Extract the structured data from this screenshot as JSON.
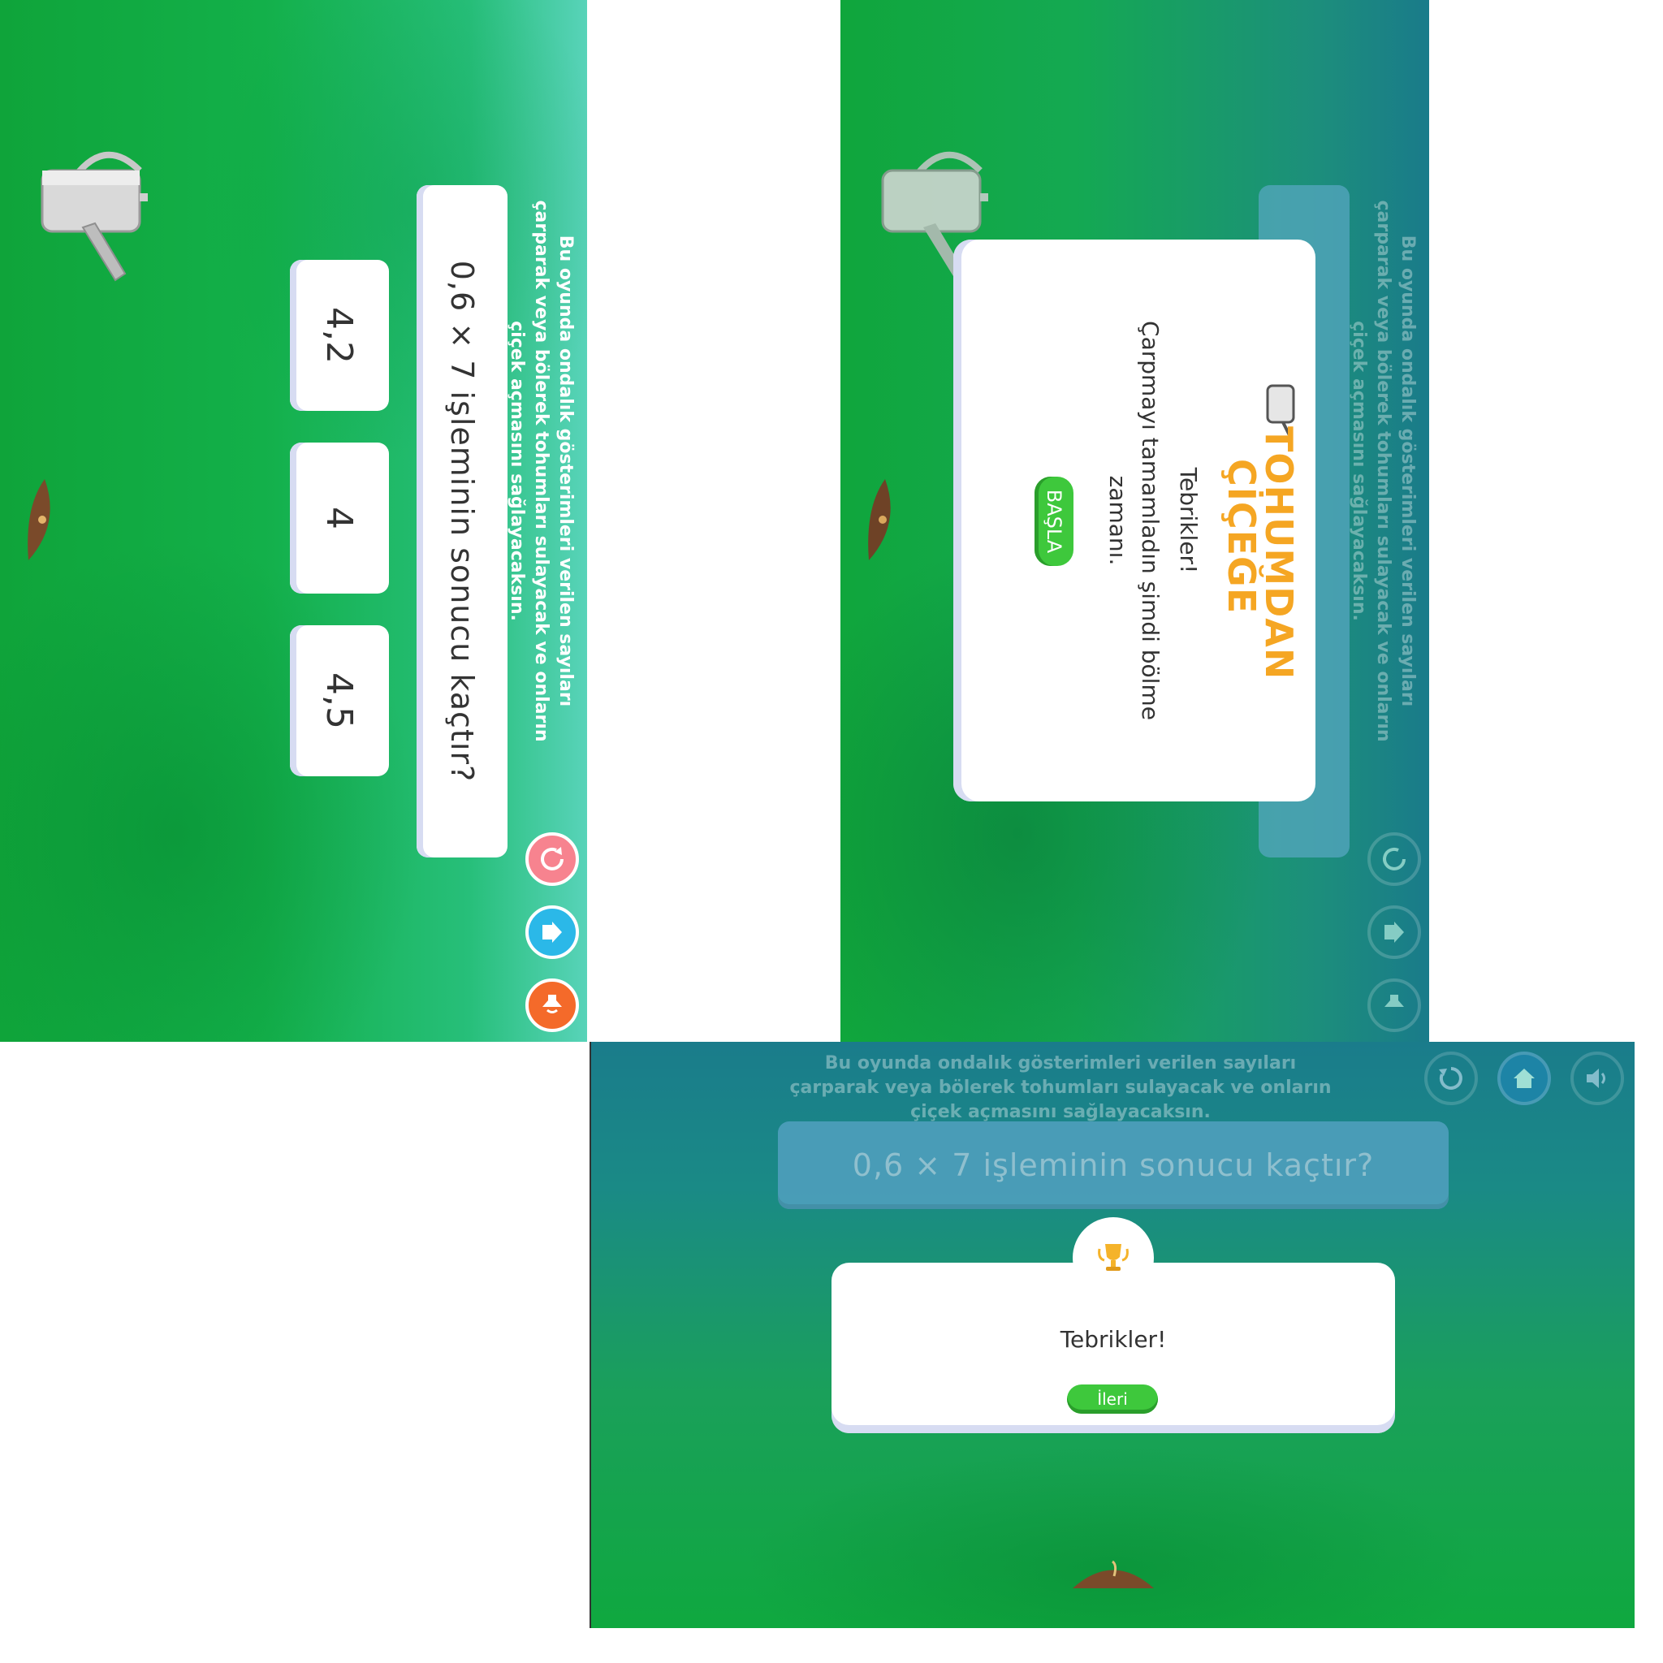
{
  "instructions": "Bu oyunda ondalık gösterimleri verilen sayıları çarparak veya bölerek tohumları sulayacak ve onların çiçek açmasını sağlayacaksın.",
  "question": "0,6 × 7 işleminin sonucu kaçtır?",
  "answers": [
    "4,2",
    "4",
    "4,5"
  ],
  "controls": {
    "restart_icon": "restart-icon",
    "home_icon": "home-icon",
    "sound_icon": "sound-icon"
  },
  "intro_modal": {
    "logo_line1": "TOHUMDAN",
    "logo_line2": "ÇİÇEĞE",
    "title": "Tebrikler!",
    "message": "Çarpmayı tamamladın şimdi bölme zamanı.",
    "start_button": "BAŞLA"
  },
  "result_modal": {
    "title": "Tebrikler!",
    "next_button": "İleri",
    "badge_icon": "trophy-icon"
  },
  "colors": {
    "green": "#3ec83c",
    "restart": "#f7838f",
    "home": "#2bb8e8",
    "sound": "#f46a2a"
  }
}
